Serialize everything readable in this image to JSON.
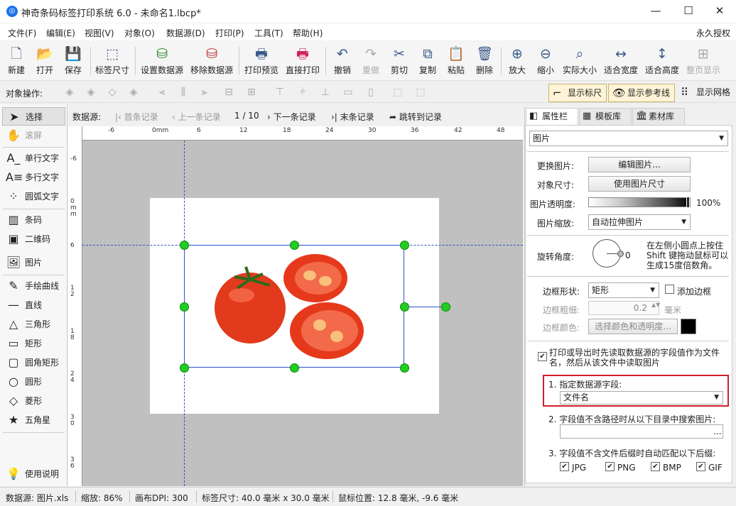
{
  "window": {
    "title": "神奇条码标签打印系统 6.0 - 未命名1.lbcp*",
    "minimize": "—",
    "maximize": "☐",
    "close": "✕"
  },
  "menu": {
    "items": [
      "文件(F)",
      "编辑(E)",
      "视图(V)",
      "对象(O)",
      "数据源(D)",
      "打印(P)",
      "工具(T)",
      "帮助(H)"
    ],
    "license": "永久授权"
  },
  "toolbar": {
    "items": [
      "新建",
      "打开",
      "保存",
      "标签尺寸",
      "设置数据源",
      "移除数据源",
      "打印预览",
      "直接打印",
      "撤销",
      "重做",
      "剪切",
      "复制",
      "粘贴",
      "删除",
      "放大",
      "缩小",
      "实际大小",
      "适合宽度",
      "适合高度",
      "整页显示"
    ]
  },
  "objbar": {
    "label": "对象操作:",
    "show_ruler": "显示标尺",
    "show_guides": "显示参考线",
    "show_grid": "显示网格"
  },
  "tools": [
    "选择",
    "滚屏",
    "单行文字",
    "多行文字",
    "圆弧文字",
    "条码",
    "二维码",
    "图片",
    "手绘曲线",
    "直线",
    "三角形",
    "矩形",
    "圆角矩形",
    "圆形",
    "菱形",
    "五角星",
    "使用说明"
  ],
  "nav": {
    "label": "数据源:",
    "first": "首条记录",
    "prev": "上一条记录",
    "position": "1 / 10",
    "next": "下一条记录",
    "last": "末条记录",
    "jump": "跳转到记录"
  },
  "ruler": {
    "h": [
      "-6",
      "0mm",
      "6",
      "12",
      "18",
      "24",
      "30",
      "36",
      "42",
      "48"
    ],
    "v": [
      "-6",
      "0mm",
      "6",
      "12",
      "18",
      "24",
      "30",
      "36"
    ]
  },
  "panel": {
    "tabs": [
      "属性栏",
      "模板库",
      "素材库"
    ],
    "type": "图片",
    "change_image_label": "更换图片:",
    "edit_image_btn": "编辑图片...",
    "size_label": "对象尺寸:",
    "use_size_btn": "使用图片尺寸",
    "opacity_label": "图片透明度:",
    "opacity_value": "100%",
    "opacity_fraction": 1.0,
    "scale_label": "图片缩放:",
    "scale_value": "自动拉伸图片",
    "rotate_label": "旋转角度:",
    "rotate_value": "0",
    "rotate_hint": "在左侧小圆点上按住Shift 键拖动鼠标可以生成15度倍数角。",
    "border_shape_label": "边框形状:",
    "border_shape_value": "矩形",
    "add_border": "添加边框",
    "border_width_label": "边框粗细:",
    "border_width_value": "0.2",
    "border_unit": "毫米",
    "border_color_label": "边框颜色:",
    "border_color_btn": "选择颜色和透明度...",
    "border_color": "#000000",
    "datasource_check": "打印或导出时先读取数据源的字段值作为文件名，然后从该文件中读取图片",
    "field_label": "1. 指定数据源字段:",
    "field_value": "文件名",
    "search_label": "2. 字段值不含路径时从以下目录中搜索图片:",
    "search_btn": "...",
    "suffix_label": "3. 字段值不含文件后缀时自动匹配以下后缀:",
    "suffixes": [
      "JPG",
      "PNG",
      "BMP",
      "GIF"
    ]
  },
  "status": {
    "datasource": "数据源: 图片.xls",
    "zoom": "缩放: 86%",
    "dpi": "画布DPI: 300",
    "label_size": "标签尺寸: 40.0 毫米 x 30.0 毫米",
    "mouse": "鼠标位置: 12.8 毫米, -9.6 毫米"
  }
}
